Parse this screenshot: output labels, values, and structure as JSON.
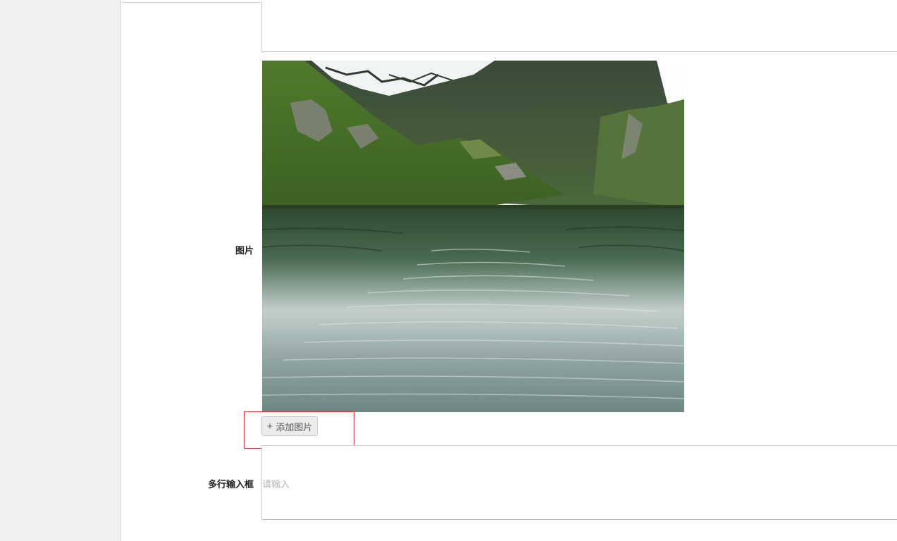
{
  "form": {
    "image_field": {
      "label": "图片",
      "add_button_label": "添加图片",
      "add_button_icon": "plus-icon"
    },
    "textarea_field": {
      "label": "多行输入框",
      "placeholder": "请输入",
      "value": ""
    }
  },
  "colors": {
    "sidebar_bg": "#efefef",
    "highlight_border": "#d9343a",
    "button_bg": "#ececec"
  }
}
